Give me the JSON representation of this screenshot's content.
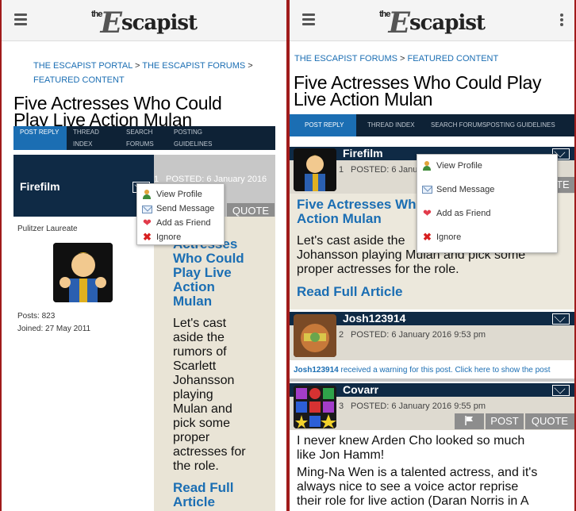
{
  "site": {
    "logo_the": "the",
    "logo_e": "E",
    "logo_rest": "scapist"
  },
  "left": {
    "breadcrumb": {
      "portal": "THE ESCAPIST PORTAL",
      "sep1": " > ",
      "forums": "THE ESCAPIST FORUMS",
      "sep2": " >",
      "featured": "FEATURED CONTENT"
    },
    "title_line1": "Five Actresses Who Could",
    "title_line2": "Play Live Action Mulan",
    "tabs": {
      "post_reply": "POST REPLY",
      "thread_index_1": "THREAD",
      "thread_index_2": "INDEX",
      "search_1": "SEARCH",
      "search_2": "FORUMS",
      "posting_1": "POSTING",
      "posting_2": "GUIDELINES"
    },
    "post": {
      "author": "Firefilm",
      "number": "1",
      "posted": "POSTED: 6 January 2016",
      "quote": "QUOTE",
      "rank": "Pulitzer Laureate",
      "posts": "Posts: 823",
      "joined": "Joined: 27 May 2011",
      "article_lines": [
        "Actresses",
        "Who Could",
        "Play Live",
        "Action",
        "Mulan"
      ],
      "body_lines": [
        "Let's cast",
        "aside the",
        "rumors of",
        "Scarlett",
        "Johansson",
        "playing",
        "Mulan and",
        "pick some",
        "proper",
        "actresses for",
        "the role."
      ],
      "read_1": "Read Full",
      "read_2": "Article"
    },
    "menu": {
      "view_profile": "View Profile",
      "send_message": "Send Message",
      "add_friend": "Add as Friend",
      "ignore": "Ignore"
    }
  },
  "right": {
    "breadcrumb": {
      "forums": "THE ESCAPIST FORUMS",
      "sep": " > ",
      "featured": "FEATURED CONTENT"
    },
    "title_line1": "Five Actresses Who Could Play",
    "title_line2": "Live Action Mulan",
    "tabs": {
      "post_reply": "POST REPLY",
      "thread_index": "THREAD INDEX",
      "search": "SEARCH FORUMS",
      "posting": "POSTING GUIDELINES"
    },
    "posts": [
      {
        "author": "Firefilm",
        "number": "1",
        "posted": "POSTED: 6 Janua",
        "quote": "OTE",
        "article_1": "Five Actresses Wh",
        "article_2": "Action Mulan",
        "body_1": "Let's cast aside the",
        "body_2": "Johansson playing Mulan and pick some",
        "body_3": "proper actresses for the role.",
        "read": "Read Full Article"
      },
      {
        "author": "Josh123914",
        "number": "2",
        "posted": "POSTED: 6 January 2016 9:53 pm",
        "warning_user": "Josh123914",
        "warning_text": " received a warning for this post. Click here to show the post"
      },
      {
        "author": "Covarr",
        "number": "3",
        "posted": "POSTED: 6 January 2016 9:55 pm",
        "post_btn": "POST",
        "quote_btn": "QUOTE",
        "body_1": "I never knew Arden Cho looked so much",
        "body_2": "like Jon Hamm!",
        "body_3": "Ming-Na Wen is a talented actress, and it's",
        "body_4": "always nice to see a voice actor reprise",
        "body_5": "their role for live action (Daran Norris in A"
      }
    ],
    "menu": {
      "view_profile": "View Profile",
      "send_message": "Send Message",
      "add_friend": "Add as Friend",
      "ignore": "Ignore"
    }
  },
  "colors": {
    "frame": "#a01b1b",
    "link": "#1b6eb3",
    "navy": "#0f2a45",
    "tab_active": "#1b6eb3"
  }
}
